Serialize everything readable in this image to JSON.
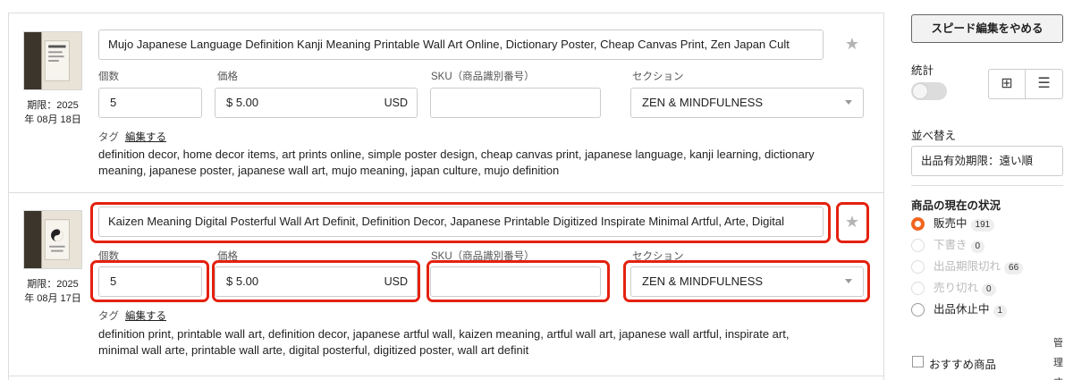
{
  "listings": [
    {
      "title": "Mujo Japanese Language Definition Kanji Meaning Printable Wall Art Online, Dictionary Poster, Cheap Canvas Print, Zen Japan Cult",
      "expiry_line1": "期限：2025",
      "expiry_line2": "年 08月 18日",
      "quantity_label": "個数",
      "quantity": "5",
      "price_label": "価格",
      "price": "$ 5.00",
      "currency": "USD",
      "sku_label": "SKU（商品識別番号）",
      "sku": "",
      "section_label": "セクション",
      "section": "ZEN & MINDFULNESS",
      "tags_label": "タグ",
      "edit_label": "編集する",
      "tags_line1": "definition decor, home decor items, art prints online, simple poster design, cheap canvas print, japanese language, kanji learning, dictionary",
      "tags_line2": "meaning, japanese poster, japanese wall art, mujo meaning, japan culture, mujo definition"
    },
    {
      "title": "Kaizen Meaning Digital Posterful Wall Art Definit, Definition Decor, Japanese Printable Digitized Inspirate Minimal Artful, Arte, Digital",
      "expiry_line1": "期限：2025",
      "expiry_line2": "年 08月 17日",
      "quantity_label": "個数",
      "quantity": "5",
      "price_label": "価格",
      "price": "$ 5.00",
      "currency": "USD",
      "sku_label": "SKU（商品識別番号）",
      "sku": "",
      "section_label": "セクション",
      "section": "ZEN & MINDFULNESS",
      "tags_label": "タグ",
      "edit_label": "編集する",
      "tags_line1": "definition print, printable wall art, definition decor, japanese artful wall, kaizen meaning, artful wall art, japanese wall artful, inspirate art,",
      "tags_line2": "minimal wall arte, printable wall arte, digital posterful, digitized poster, wall art definit"
    }
  ],
  "sidebar": {
    "stop_quick_edit": "スピード編集をやめる",
    "stats_label": "統計",
    "sort_label": "並べ替え",
    "sort_value": "出品有効期限：遠い順",
    "status_title": "商品の現在の状況",
    "statuses": [
      {
        "label": "販売中",
        "count": "191"
      },
      {
        "label": "下書き",
        "count": "0"
      },
      {
        "label": "出品期限切れ",
        "count": "66"
      },
      {
        "label": "売り切れ",
        "count": "0"
      },
      {
        "label": "出品休止中",
        "count": "1"
      }
    ],
    "featured_label": "おすすめ商品",
    "manage_line1": "管",
    "manage_line2": "理",
    "manage_line3": "す"
  },
  "colors": {
    "highlight": "#e4210f",
    "radio_active": "#f1641e"
  }
}
